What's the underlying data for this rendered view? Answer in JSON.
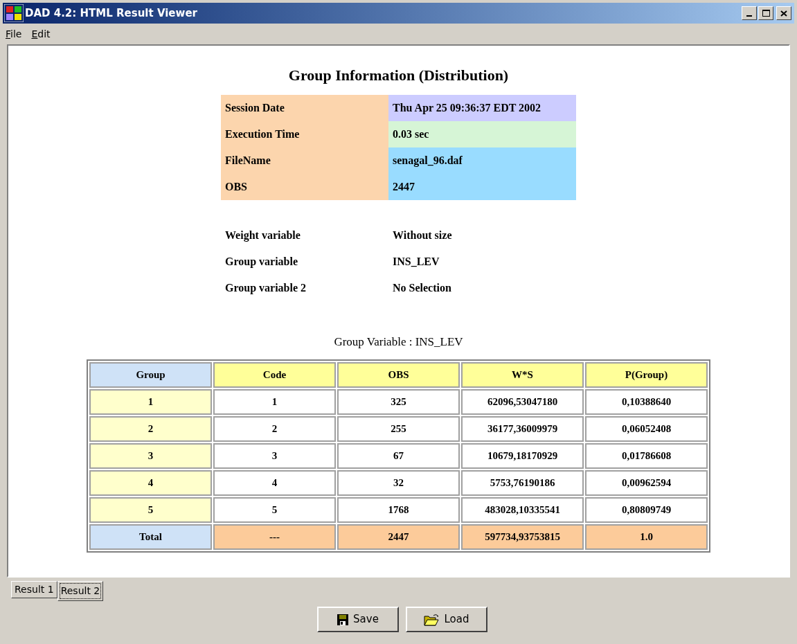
{
  "window": {
    "title": "DAD 4.2: HTML Result Viewer"
  },
  "menu": [
    "File",
    "Edit"
  ],
  "report": {
    "title": "Group Information (Distribution)",
    "info": [
      {
        "label": "Session Date",
        "value": "Thu Apr 25 09:36:37 EDT 2002",
        "color": "#ccccff"
      },
      {
        "label": "Execution Time",
        "value": "0.03 sec",
        "color": "#d6f5d6"
      },
      {
        "label": "FileName",
        "value": "senagal_96.daf",
        "color": "#99dcff"
      },
      {
        "label": "OBS",
        "value": "2447",
        "color": "#99dcff"
      }
    ],
    "variables": [
      {
        "label": "Weight variable",
        "value": "Without size"
      },
      {
        "label": "Group variable",
        "value": "INS_LEV"
      },
      {
        "label": "Group variable 2",
        "value": "No Selection"
      }
    ],
    "caption": "Group Variable : INS_LEV",
    "table": {
      "columns": [
        "Group",
        "Code",
        "OBS",
        "W*S",
        "P(Group)"
      ],
      "rows": [
        {
          "kind": "data",
          "cells": [
            "1",
            "1",
            "325",
            "62096,53047180",
            "0,10388640"
          ]
        },
        {
          "kind": "data",
          "cells": [
            "2",
            "2",
            "255",
            "36177,36009979",
            "0,06052408"
          ]
        },
        {
          "kind": "data",
          "cells": [
            "3",
            "3",
            "67",
            "10679,18170929",
            "0,01786608"
          ]
        },
        {
          "kind": "data",
          "cells": [
            "4",
            "4",
            "32",
            "5753,76190186",
            "0,00962594"
          ]
        },
        {
          "kind": "data",
          "cells": [
            "5",
            "5",
            "1768",
            "483028,10335541",
            "0,80809749"
          ]
        },
        {
          "kind": "total",
          "cells": [
            "Total",
            "---",
            "2447",
            "597734,93753815",
            "1.0"
          ]
        }
      ]
    }
  },
  "tabs": [
    {
      "label": "Result 1",
      "selected": false
    },
    {
      "label": "Result 2",
      "selected": true
    }
  ],
  "buttons": [
    {
      "kind": "save",
      "label": "Save"
    },
    {
      "kind": "load",
      "label": "Load"
    }
  ]
}
